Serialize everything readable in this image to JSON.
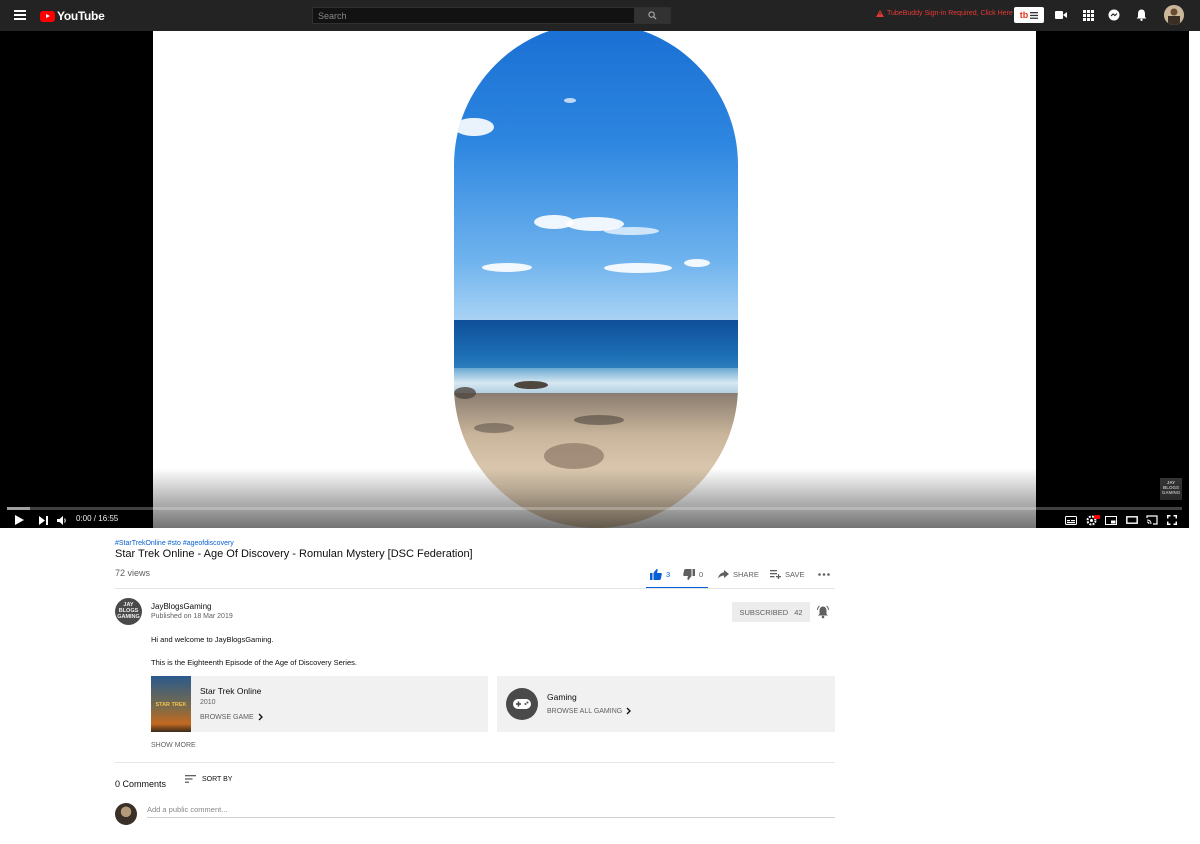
{
  "header": {
    "brand": "YouTube",
    "search": {
      "placeholder": "Search",
      "value": ""
    },
    "tubebuddy_alert": "TubeBuddy Sign-in Required, Click Here",
    "tubebuddy_badge": "tb",
    "icons": [
      "menu-icon",
      "search-icon",
      "warning-icon",
      "create-video-icon",
      "apps-icon",
      "messages-icon",
      "notifications-icon"
    ]
  },
  "player": {
    "time_display": "0:00 / 16:55",
    "progress_fraction": 0.0,
    "watermark": "JAY BLOGS GAMING",
    "controls": [
      "play-icon",
      "next-icon",
      "volume-icon",
      "subtitles-icon",
      "settings-icon",
      "miniplayer-icon",
      "theater-icon",
      "cast-icon",
      "fullscreen-icon"
    ],
    "settings_badge": "HD"
  },
  "video": {
    "hashtags": "#StarTrekOnline #sto #ageofdiscovery",
    "title": "Star Trek Online - Age Of Discovery - Romulan Mystery [DSC Federation]",
    "views": "72 views",
    "likes": "3",
    "dislikes": "0",
    "share_label": "SHARE",
    "save_label": "SAVE"
  },
  "channel": {
    "name": "JayBlogsGaming",
    "avatar_text": "JAY BLOGS GAMING",
    "published": "Published on 18 Mar 2019",
    "subscribe_label": "SUBSCRIBED",
    "subscriber_count": "42"
  },
  "description": {
    "line1": "Hi and welcome to JayBlogsGaming.",
    "line2": "This is the Eighteenth Episode of the Age of Discovery Series."
  },
  "cards": {
    "game": {
      "title": "Star Trek Online",
      "year": "2010",
      "link": "BROWSE GAME",
      "thumb_text": "STAR TREK"
    },
    "category": {
      "title": "Gaming",
      "link": "BROWSE ALL GAMING"
    }
  },
  "show_more": "SHOW MORE",
  "comments": {
    "count": "0 Comments",
    "sort_label": "SORT BY",
    "placeholder": "Add a public comment..."
  },
  "colors": {
    "accent": "#065fd4",
    "brand_red": "#ff0000",
    "topbar": "#232323"
  }
}
